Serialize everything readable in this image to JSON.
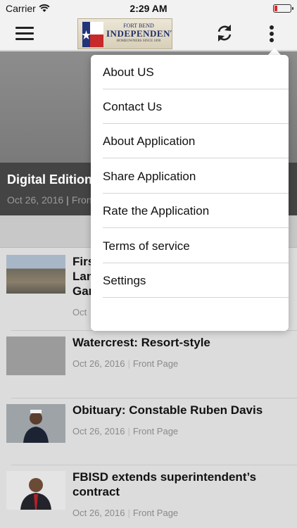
{
  "status_bar": {
    "carrier": "Carrier",
    "time": "2:29 AM",
    "battery_level": 0.2,
    "battery_color": "#e0262b"
  },
  "nav": {
    "menu_icon": "hamburger-icon",
    "logo": {
      "top_text": "FORT BEND",
      "main_text": "INDEPENDENT",
      "sub_text": "HOMEOWNERS SINCE 1890"
    },
    "refresh_icon": "refresh-icon",
    "more_icon": "more-vertical-icon"
  },
  "hero": {
    "title": "Digital Edition",
    "date": "Oct 26, 2016",
    "category": "Fron"
  },
  "articles": [
    {
      "title": "Firs\nLan\nGar",
      "date": "Oct",
      "category": ""
    },
    {
      "title": "Watercrest: Resort-style",
      "date": "Oct 26, 2016",
      "category": "Front Page"
    },
    {
      "title": "Obituary: Constable Ruben Davis",
      "date": "Oct 26, 2016",
      "category": "Front Page"
    },
    {
      "title": "FBISD extends superintendent’s contract",
      "date": "Oct 26, 2016",
      "category": "Front Page"
    }
  ],
  "menu": {
    "items": [
      "About US",
      "Contact Us",
      "About Application",
      "Share Application",
      "Rate the Application",
      "Terms of service",
      "Settings"
    ]
  },
  "colors": {
    "bar_background": "#f2f2f2",
    "hero_caption": "#444444",
    "meta_text": "#8a8a8a"
  }
}
